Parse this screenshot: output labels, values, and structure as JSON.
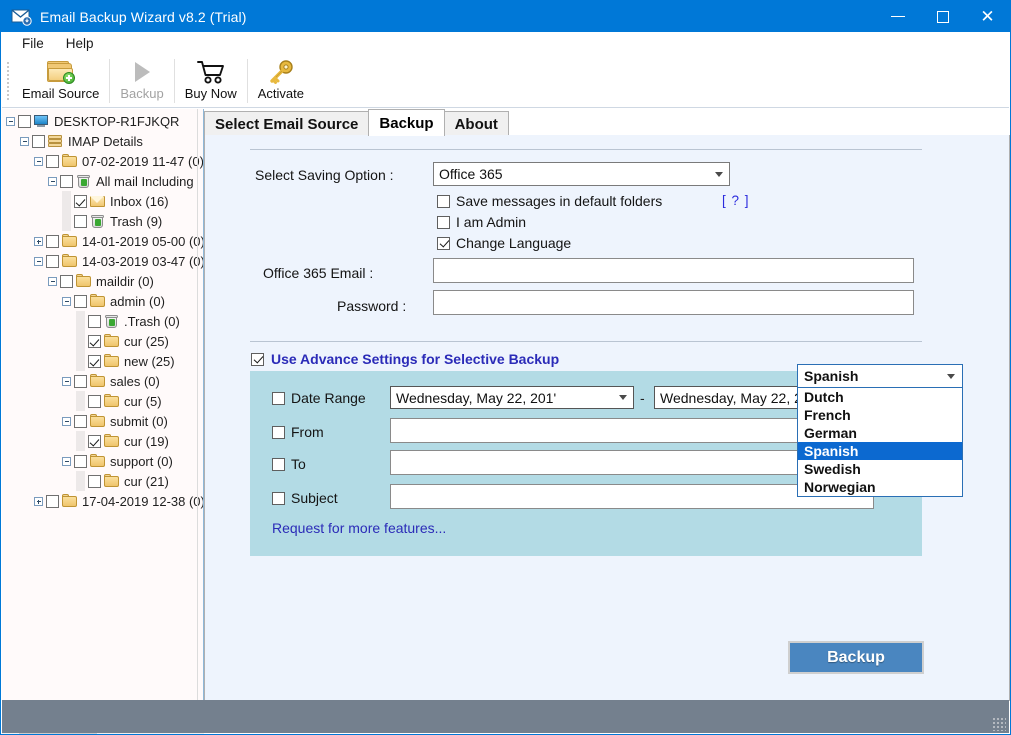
{
  "window": {
    "title": "Email Backup Wizard v8.2 (Trial)",
    "icon": "mail-app-icon",
    "controls": {
      "minimize": "minimize-icon",
      "maximize": "maximize-icon",
      "close": "close-icon"
    },
    "accent_color": "#0078d7"
  },
  "menu": {
    "items": [
      {
        "label": "File"
      },
      {
        "label": "Help"
      }
    ]
  },
  "toolbar": {
    "buttons": [
      {
        "label": "Email Source",
        "icon": "folder-add-icon",
        "enabled": true
      },
      {
        "label": "Backup",
        "icon": "play-triangle-icon",
        "enabled": false
      },
      {
        "label": "Buy Now",
        "icon": "shopping-cart-icon",
        "enabled": true
      },
      {
        "label": "Activate",
        "icon": "key-icon",
        "enabled": true
      }
    ]
  },
  "tabs": [
    {
      "label": "Select Email Source",
      "active": false
    },
    {
      "label": "Backup",
      "active": true
    },
    {
      "label": "About",
      "active": false
    }
  ],
  "tree": {
    "nodes": [
      {
        "label": "DESKTOP-R1FJKQR",
        "depth": 0,
        "expander": "minus",
        "checked": false,
        "icon": "computer-icon"
      },
      {
        "label": "IMAP Details",
        "depth": 1,
        "expander": "minus",
        "checked": false,
        "icon": "stack-icon"
      },
      {
        "label": "07-02-2019 11-47 (0)",
        "depth": 2,
        "expander": "minus",
        "checked": false,
        "icon": "folder-icon"
      },
      {
        "label": "All mail Including",
        "depth": 3,
        "expander": "minus",
        "checked": false,
        "icon": "trash-icon"
      },
      {
        "label": "Inbox (16)",
        "depth": 4,
        "expander": "none",
        "checked": true,
        "icon": "mail-icon"
      },
      {
        "label": "Trash (9)",
        "depth": 4,
        "expander": "none",
        "checked": false,
        "icon": "trash-icon"
      },
      {
        "label": "14-01-2019 05-00 (0)",
        "depth": 2,
        "expander": "plus",
        "checked": false,
        "icon": "folder-icon"
      },
      {
        "label": "14-03-2019 03-47 (0)",
        "depth": 2,
        "expander": "minus",
        "checked": false,
        "icon": "folder-icon"
      },
      {
        "label": "maildir (0)",
        "depth": 3,
        "expander": "minus",
        "checked": false,
        "icon": "folder-icon"
      },
      {
        "label": "admin (0)",
        "depth": 4,
        "expander": "minus",
        "checked": false,
        "icon": "folder-icon"
      },
      {
        "label": ".Trash (0)",
        "depth": 5,
        "expander": "none",
        "checked": false,
        "icon": "trash-icon"
      },
      {
        "label": "cur (25)",
        "depth": 5,
        "expander": "none",
        "checked": true,
        "icon": "folder-icon"
      },
      {
        "label": "new (25)",
        "depth": 5,
        "expander": "none",
        "checked": true,
        "icon": "folder-icon"
      },
      {
        "label": "sales (0)",
        "depth": 4,
        "expander": "minus",
        "checked": false,
        "icon": "folder-icon"
      },
      {
        "label": "cur (5)",
        "depth": 5,
        "expander": "none",
        "checked": false,
        "icon": "folder-icon"
      },
      {
        "label": "submit (0)",
        "depth": 4,
        "expander": "minus",
        "checked": false,
        "icon": "folder-icon"
      },
      {
        "label": "cur (19)",
        "depth": 5,
        "expander": "none",
        "checked": true,
        "icon": "folder-icon"
      },
      {
        "label": "support (0)",
        "depth": 4,
        "expander": "minus",
        "checked": false,
        "icon": "folder-icon"
      },
      {
        "label": "cur (21)",
        "depth": 5,
        "expander": "none",
        "checked": false,
        "icon": "folder-icon"
      },
      {
        "label": "17-04-2019 12-38 (0)",
        "depth": 2,
        "expander": "plus",
        "checked": false,
        "icon": "folder-icon"
      }
    ],
    "hscroll": {
      "left_arrow": "‹",
      "right_arrow": "›"
    }
  },
  "backup_form": {
    "saving_option_label": "Select Saving Option :",
    "saving_option_value": "Office 365",
    "save_default_folders_label": "Save messages in default folders",
    "save_default_folders_checked": false,
    "help_link": "[ ? ]",
    "i_am_admin_label": "I am Admin",
    "i_am_admin_checked": false,
    "change_language_label": "Change Language",
    "change_language_checked": true,
    "language_selected": "Spanish",
    "language_options": [
      {
        "label": "Dutch",
        "selected": false
      },
      {
        "label": "French",
        "selected": false
      },
      {
        "label": "German",
        "selected": false
      },
      {
        "label": "Spanish",
        "selected": true
      },
      {
        "label": "Swedish",
        "selected": false
      },
      {
        "label": "Norwegian",
        "selected": false
      }
    ],
    "email_label": "Office 365 Email      :",
    "email_value": "",
    "password_label": "Password :",
    "password_value": ""
  },
  "advance": {
    "title": "Use Advance Settings for Selective Backup",
    "checked": true,
    "panel_color": "#b3dbe5",
    "date_range_label": "Date Range",
    "date_range_checked": false,
    "date_from_value": "Wednesday,      May      22, 201'",
    "date_to_value": "Wednesday,      May      22, 201'",
    "date_separator": "-",
    "from_label": "From",
    "from_checked": false,
    "from_value": "",
    "to_label": "To",
    "to_checked": false,
    "to_value": "",
    "subject_label": "Subject",
    "subject_checked": false,
    "subject_value": "",
    "request_link": "Request for more features..."
  },
  "actions": {
    "backup_button": "Backup"
  },
  "statusbar": {
    "text": "",
    "resize_grip": "resize-grip-icon"
  }
}
